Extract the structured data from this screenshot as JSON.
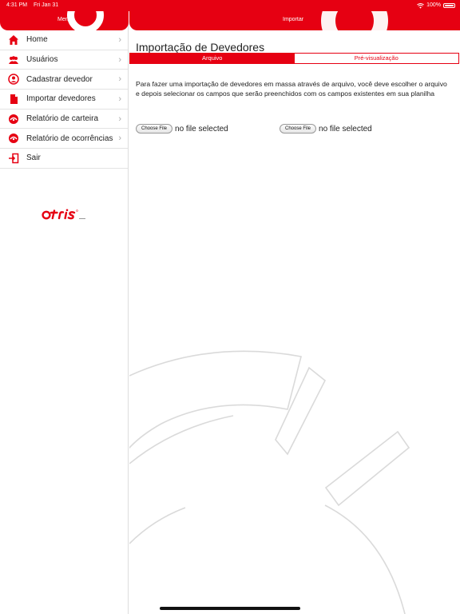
{
  "status_bar": {
    "time": "4:31 PM",
    "date": "Fri Jan 31",
    "battery": "100%"
  },
  "sidebar": {
    "title": "Menu",
    "items": [
      {
        "label": "Home",
        "icon": "home-icon"
      },
      {
        "label": "Usuários",
        "icon": "users-icon"
      },
      {
        "label": "Cadastrar devedor",
        "icon": "user-add-icon"
      },
      {
        "label": "Importar devedores",
        "icon": "document-icon"
      },
      {
        "label": "Relatório de carteira",
        "icon": "gauge-icon"
      },
      {
        "label": "Relatório de ocorrências",
        "icon": "gauge-icon"
      },
      {
        "label": "Sair",
        "icon": "logout-icon"
      }
    ],
    "logo_text": "OTRIS"
  },
  "main": {
    "header_title": "Importar",
    "page_title": "Importação de Devedores",
    "tabs": [
      {
        "label": "Arquivo",
        "active": true
      },
      {
        "label": "Pré-visualização",
        "active": false
      }
    ],
    "description": "Para fazer uma importação de devedores em massa através de arquivo, você deve escolher o arquivo e depois selecionar os campos que serão preenchidos com os campos existentes em sua planilha",
    "file_inputs": [
      {
        "button": "Choose File",
        "status": "no file selected"
      },
      {
        "button": "Choose File",
        "status": "no file selected"
      }
    ]
  },
  "colors": {
    "accent": "#e60012"
  }
}
